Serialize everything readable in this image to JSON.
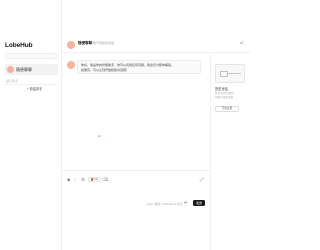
{
  "sidebar": {
    "brand": "LobeHub",
    "active_session": {
      "name": "随便聊聊"
    },
    "group_label": "默认助手",
    "add_group_label": "+ 新建助手"
  },
  "header": {
    "title": "随便聊聊",
    "subtitle": "用于轻松的对话"
  },
  "chat": {
    "message_lines": [
      "你好，我是你的智能助手，你可以问我任何问题，我会尽力帮你解答。",
      "如果有，可以立刻开始和我对话吧！"
    ],
    "pointer_text": "Hi"
  },
  "right_panel": {
    "title": "历史对话",
    "desc_lines": [
      "在对话中生成的",
      "内容可在此查看"
    ],
    "button_label": "开启设置"
  },
  "input": {
    "token_label": "0.0k",
    "send_hint": "Enter 发送 / Shift+Enter 换行",
    "send_label": "发送"
  },
  "colors": {
    "accent": "#e0543a",
    "avatar": "#f4b39a",
    "send_button": "#1c1c1c"
  }
}
